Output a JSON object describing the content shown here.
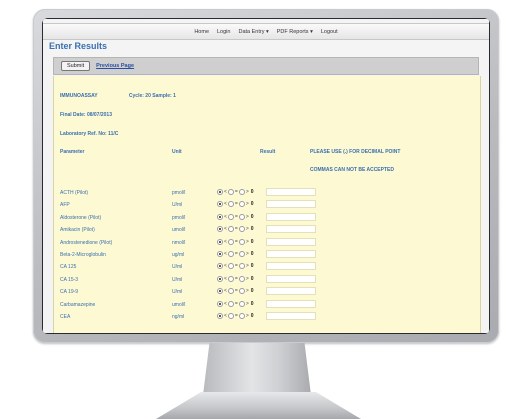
{
  "nav": {
    "items": [
      "Home",
      "Login",
      "Data Entry ▾",
      "PDF Reports ▾",
      "Logout"
    ]
  },
  "page_title": "Enter Results",
  "toolbar": {
    "submit_label": "Submit",
    "previous_label": "Previous Page"
  },
  "form": {
    "assay": "IMMUNOASSAY",
    "cycle": "Cycle: 20 Sample: 1",
    "final_date": "Final Date: 08/07/2013",
    "lab_ref": "Laboratory Ref. No: 11/C",
    "headers": {
      "parameter": "Parameter",
      "unit": "Unit",
      "result": "Result",
      "note1": "PLEASE USE (.) FOR DECIMAL POINT",
      "note2": "COMMAS CAN NOT BE ACCEPTED"
    },
    "radio_symbols": [
      "<",
      "=",
      ">"
    ],
    "rows": [
      {
        "param": "ACTH (Pilot)",
        "unit": "pmol/l",
        "value": "0"
      },
      {
        "param": "AFP",
        "unit": "U/ml",
        "value": "0"
      },
      {
        "param": "Aldosterone (Pilot)",
        "unit": "pmol/l",
        "value": "0"
      },
      {
        "param": "Amikacin (Pilot)",
        "unit": "umol/l",
        "value": "0"
      },
      {
        "param": "Androstenedione (Pilot)",
        "unit": "nmol/l",
        "value": "0"
      },
      {
        "param": "Beta-2-Microglobulin",
        "unit": "ug/ml",
        "value": "0"
      },
      {
        "param": "CA 125",
        "unit": "U/ml",
        "value": "0"
      },
      {
        "param": "CA 15-3",
        "unit": "U/ml",
        "value": "0"
      },
      {
        "param": "CA 19-9",
        "unit": "U/ml",
        "value": "0"
      },
      {
        "param": "Carbamazepine",
        "unit": "umol/l",
        "value": "0"
      },
      {
        "param": "CEA",
        "unit": "ng/ml",
        "value": "0"
      }
    ]
  }
}
